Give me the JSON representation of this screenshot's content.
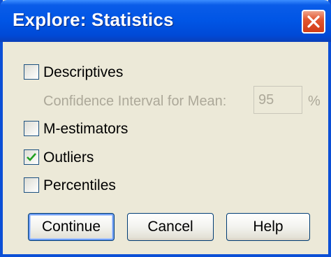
{
  "window": {
    "title": "Explore: Statistics",
    "close_icon": "close-icon"
  },
  "options": {
    "descriptives": {
      "label": "Descriptives",
      "checked": false
    },
    "confidence": {
      "label": "Confidence Interval for Mean:",
      "value": "95",
      "unit": "%"
    },
    "m_estimators": {
      "label": "M-estimators",
      "checked": false
    },
    "outliers": {
      "label": "Outliers",
      "checked": true
    },
    "percentiles": {
      "label": "Percentiles",
      "checked": false
    }
  },
  "buttons": {
    "continue": "Continue",
    "cancel": "Cancel",
    "help": "Help"
  },
  "colors": {
    "titlebar": "#0055e5",
    "face": "#ece9d8",
    "check": "#21a121"
  }
}
